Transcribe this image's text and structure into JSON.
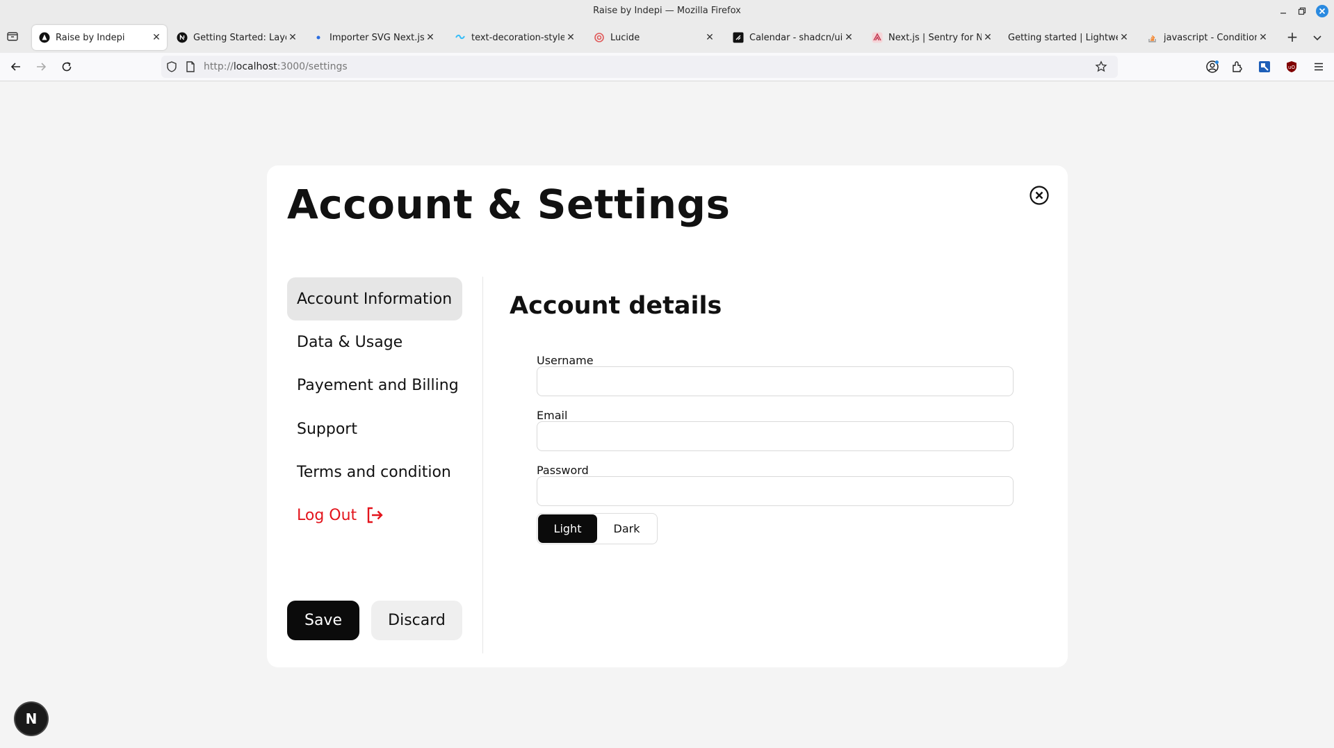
{
  "window": {
    "title": "Raise by Indepi — Mozilla Firefox"
  },
  "tabs": [
    {
      "label": "Raise by Indepi",
      "icon": "raise-favicon-icon",
      "active": true
    },
    {
      "label": "Getting Started: Layout",
      "icon": "nextjs-favicon-icon"
    },
    {
      "label": "Importer SVG Next.js",
      "icon": "dot-favicon-icon"
    },
    {
      "label": "text-decoration-style - T",
      "icon": "tailwind-favicon-icon"
    },
    {
      "label": "Lucide",
      "icon": "lucide-favicon-icon"
    },
    {
      "label": "Calendar - shadcn/ui",
      "icon": "shadcn-favicon-icon"
    },
    {
      "label": "Next.js | Sentry for Next",
      "icon": "sentry-favicon-icon"
    },
    {
      "label": "Getting started | Lightweigh",
      "icon": "none"
    },
    {
      "label": "javascript - Conditionally",
      "icon": "stackoverflow-favicon-icon"
    }
  ],
  "navbar": {
    "url_scheme": "http://",
    "url_host": "localhost",
    "url_path": ":3000/settings"
  },
  "page": {
    "title": "Account & Settings",
    "menu": [
      {
        "label": "Account Information",
        "active": true
      },
      {
        "label": "Data & Usage"
      },
      {
        "label": "Payement and Billing"
      },
      {
        "label": "Support"
      },
      {
        "label": "Terms and condition"
      },
      {
        "label": "Log Out",
        "danger": true
      }
    ],
    "section_title": "Account details",
    "fields": [
      {
        "label": "Username",
        "value": ""
      },
      {
        "label": "Email",
        "value": ""
      },
      {
        "label": "Password",
        "value": ""
      }
    ],
    "theme_options": [
      "Light",
      "Dark"
    ],
    "theme_selected": "Light",
    "save_label": "Save",
    "discard_label": "Discard"
  },
  "dev_badge": {
    "label": "N"
  },
  "colors": {
    "danger": "#e3141c",
    "primary": "#0b0b0b",
    "active_menu_bg": "#e6e6e6",
    "page_bg": "#f4f4f4"
  }
}
